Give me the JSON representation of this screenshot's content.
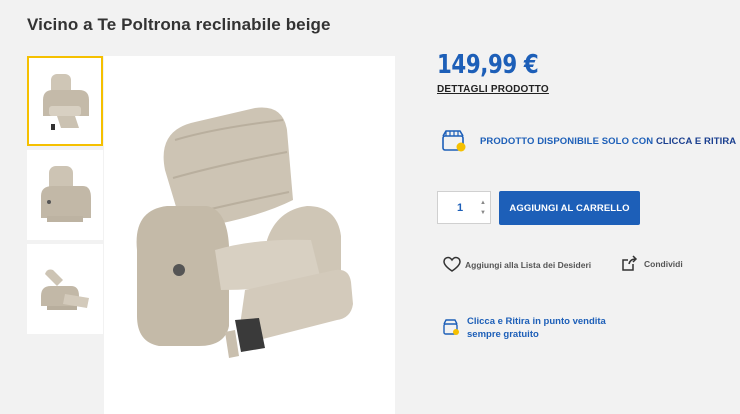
{
  "product": {
    "title": "Vicino a Te Poltrona reclinabile beige",
    "price": "149,99 €",
    "details_link": "DETTAGLI PRODOTTO"
  },
  "thumbnails": [
    {
      "icon": "recliner-front-thumb",
      "active": true
    },
    {
      "icon": "recliner-side-thumb",
      "active": false
    },
    {
      "icon": "recliner-extended-thumb",
      "active": false
    }
  ],
  "availability": {
    "icon": "store-icon",
    "text_prefix": "PRODOTTO DISPONIBILE SOLO CON ",
    "text_highlight": "CLICCA E RITIRA"
  },
  "cart": {
    "quantity": "1",
    "add_label": "AGGIUNGI AL CARRELLO"
  },
  "actions": {
    "wishlist_label": "Aggiungi alla Lista dei Desideri",
    "share_label": "Condividi"
  },
  "pickup": {
    "icon": "store-icon",
    "text": "Clicca e Ritira in punto vendita sempre gratuito"
  },
  "colors": {
    "accent": "#1d5fb8",
    "thumb_active_border": "#f5c000",
    "background": "#f2f2f2"
  }
}
